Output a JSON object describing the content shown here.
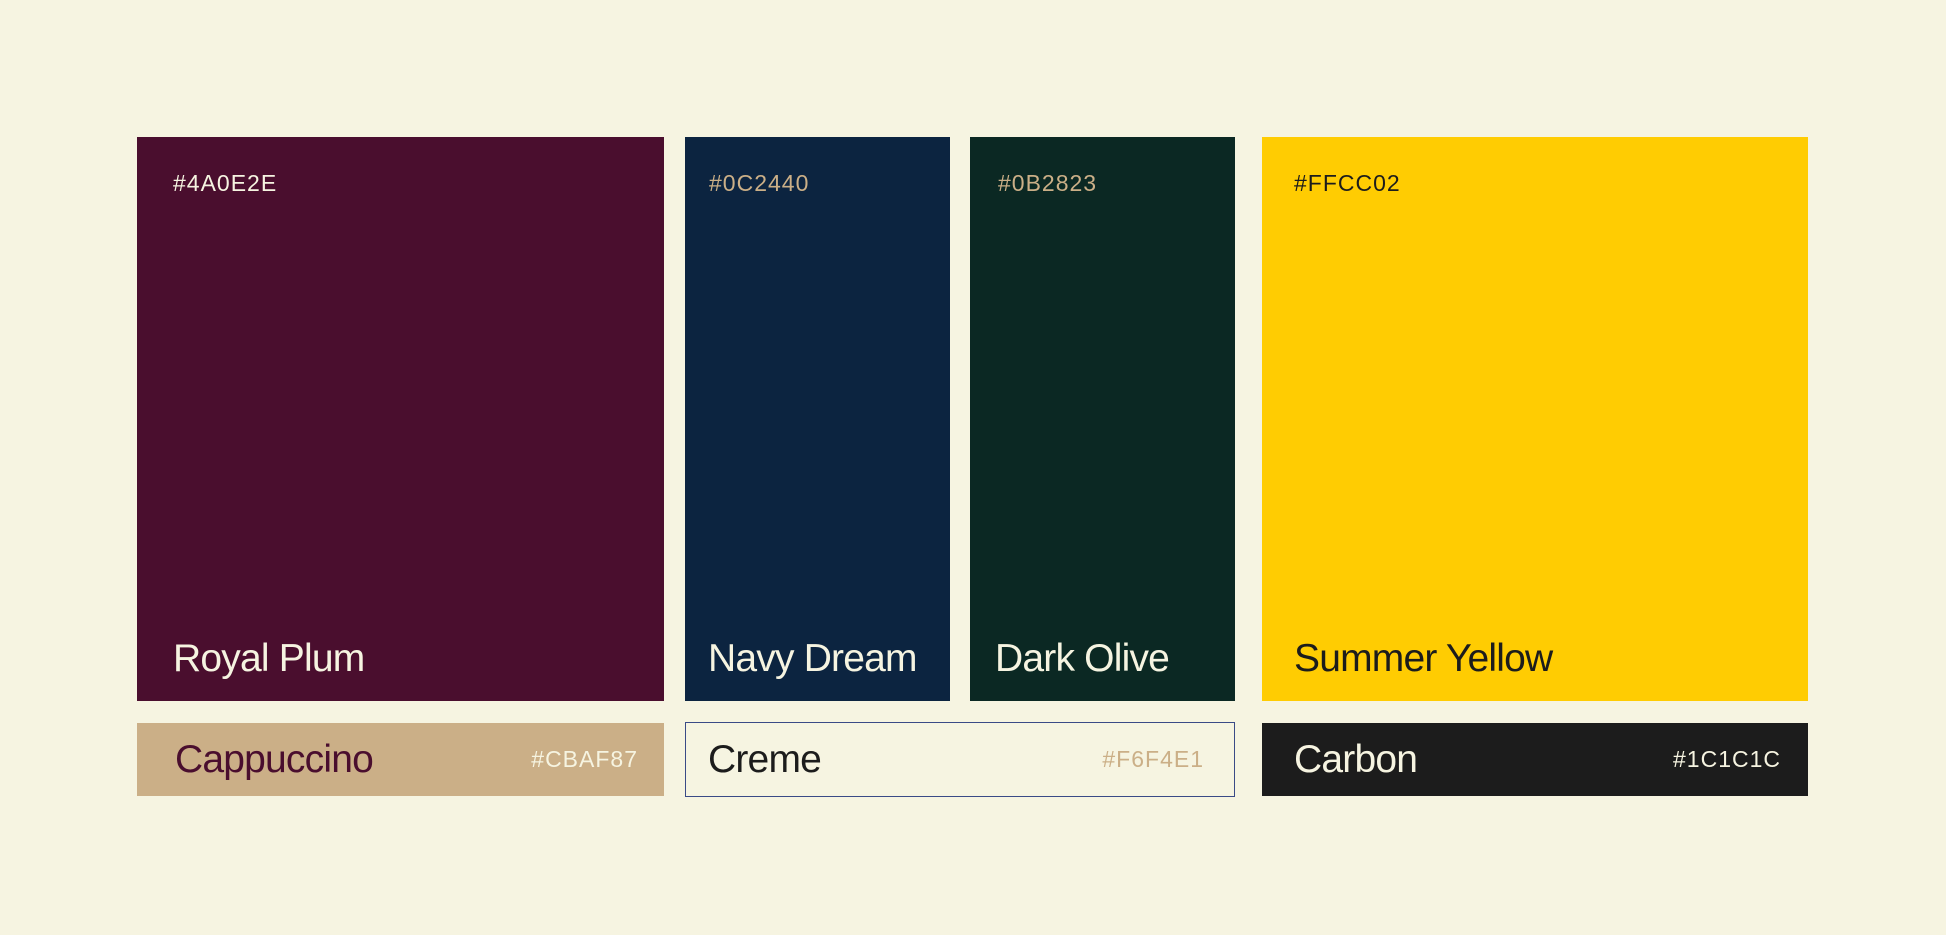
{
  "swatches": {
    "royal_plum": {
      "name": "Royal Plum",
      "hex_label": "#4A0E2E",
      "color": "#4A0E2E",
      "text_color": "#F6F4E1"
    },
    "navy_dream": {
      "name": "Navy Dream",
      "hex_label": "#0C2440",
      "color": "#0C2440",
      "text_color": "#F6F4E1",
      "hex_text_color": "#CBAF87"
    },
    "dark_olive": {
      "name": "Dark Olive",
      "hex_label": "#0B2823",
      "color": "#0B2823",
      "text_color": "#F6F4E1",
      "hex_text_color": "#CBAF87"
    },
    "summer_yellow": {
      "name": "Summer Yellow",
      "hex_label": "#FFCC02",
      "color": "#FFCC02",
      "text_color": "#1C1C1C"
    },
    "cappuccino": {
      "name": "Cappuccino",
      "hex_label": "#CBAF87",
      "color": "#CBAF87",
      "text_color": "#4A0E2E",
      "hex_text_color": "#F6F4E1"
    },
    "creme": {
      "name": "Creme",
      "hex_label": "#F6F4E1",
      "color": "#F6F4E1",
      "text_color": "#1C1C1C",
      "hex_text_color": "#CBAF87"
    },
    "carbon": {
      "name": "Carbon",
      "hex_label": "#1C1C1C",
      "color": "#1C1C1C",
      "text_color": "#F6F4E1"
    }
  },
  "page_background": "#F6F4E1"
}
